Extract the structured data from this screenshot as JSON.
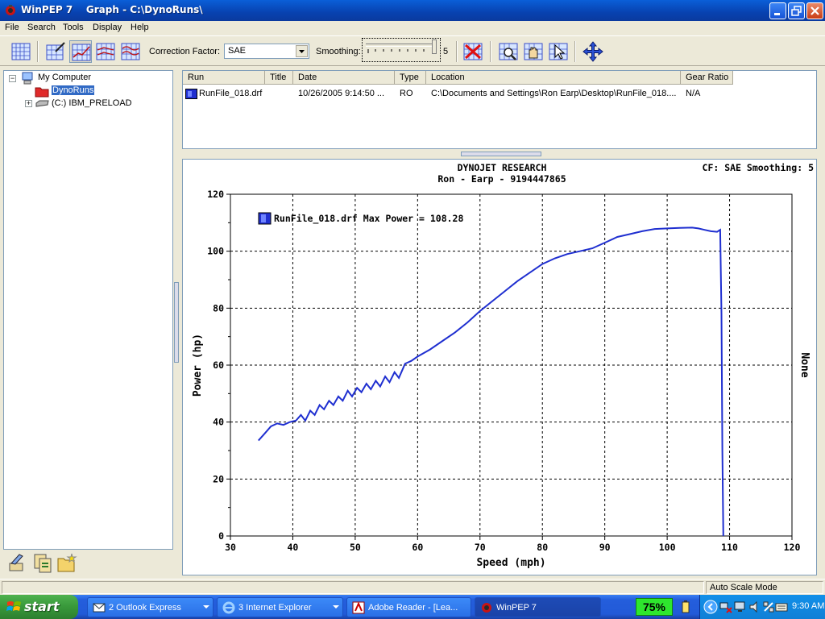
{
  "window": {
    "title": "WinPEP 7    Graph - C:\\DynoRuns\\"
  },
  "menu": [
    "File",
    "Search",
    "Tools",
    "Display",
    "Help"
  ],
  "toolbar": {
    "correction_label": "Correction Factor:",
    "correction_value": "SAE",
    "smoothing_label": "Smoothing:",
    "smoothing_value": "5"
  },
  "tree": {
    "root": "My Computer",
    "selected": "DynoRuns",
    "drive": "(C:) IBM_PRELOAD"
  },
  "run_list": {
    "headers": [
      "Run",
      "Title",
      "Date",
      "Type",
      "Location",
      "Gear Ratio"
    ],
    "rows": [
      {
        "run": "RunFile_018.drf",
        "title": "",
        "date": "10/26/2005 9:14:50 ...",
        "type": "RO",
        "location": "C:\\Documents and Settings\\Ron Earp\\Desktop\\RunFile_018....",
        "gear_ratio": "N/A"
      }
    ]
  },
  "graph": {
    "header1": "DYNOJET RESEARCH",
    "header2": "Ron - Earp - 9194447865",
    "cf_text": "CF: SAE  Smoothing: 5",
    "right_axis_label": "None",
    "line_color": "#1f2fd0"
  },
  "chart_data": {
    "type": "line",
    "title": "DYNOJET RESEARCH",
    "xlabel": "Speed (mph)",
    "ylabel": "Power (hp)",
    "xlim": [
      30,
      120
    ],
    "ylim": [
      0,
      120
    ],
    "xticks": [
      30,
      40,
      50,
      60,
      70,
      80,
      90,
      100,
      110,
      120
    ],
    "yticks": [
      0,
      20,
      40,
      60,
      80,
      100,
      120
    ],
    "grid": true,
    "legend": "top-left",
    "series": [
      {
        "name": "RunFile_018.drf Max Power = 108.28",
        "color": "#1f2fd0",
        "x": [
          34.5,
          35.5,
          36.5,
          37.5,
          38.5,
          39.5,
          40.5,
          41.3,
          42.0,
          42.8,
          43.5,
          44.3,
          45.0,
          45.8,
          46.5,
          47.3,
          48.0,
          48.8,
          49.5,
          50.3,
          51.0,
          51.8,
          52.5,
          53.3,
          54.0,
          54.8,
          55.5,
          56.3,
          57.0,
          57.6,
          58.0,
          59.0,
          60.0,
          62.0,
          64.0,
          66.0,
          68.0,
          70.0,
          72.0,
          74.0,
          76.0,
          78.0,
          80.0,
          82.0,
          84.0,
          86.0,
          88.0,
          90.0,
          92.0,
          94.0,
          96.0,
          98.0,
          100.0,
          102.0,
          104.0,
          105.0,
          106.0,
          107.0,
          108.0,
          108.5,
          108.7,
          108.85,
          109.0
        ],
        "y": [
          33.5,
          36.0,
          38.5,
          39.5,
          39.0,
          40.0,
          40.5,
          42.5,
          40.5,
          44.0,
          42.5,
          46.0,
          44.5,
          47.5,
          46.0,
          49.0,
          47.5,
          51.0,
          49.0,
          52.0,
          50.5,
          53.5,
          51.5,
          54.5,
          52.5,
          56.0,
          54.0,
          57.5,
          55.5,
          58.5,
          60.5,
          61.5,
          63.0,
          65.5,
          68.5,
          71.5,
          75.0,
          79.0,
          82.5,
          86.0,
          89.5,
          92.5,
          95.5,
          97.5,
          99.0,
          100.0,
          101.0,
          103.0,
          105.0,
          106.0,
          107.0,
          107.8,
          108.0,
          108.2,
          108.28,
          108.0,
          107.5,
          107.0,
          106.8,
          107.5,
          78.0,
          30.0,
          0.0
        ]
      }
    ]
  },
  "status": {
    "mode": "Auto Scale Mode"
  },
  "taskbar": {
    "start": "start",
    "tasks": [
      "2 Outlook Express",
      "3 Internet Explorer",
      "Adobe Reader - [Lea...",
      "WinPEP 7"
    ],
    "battery": "75%",
    "clock": "9:30 AM"
  }
}
